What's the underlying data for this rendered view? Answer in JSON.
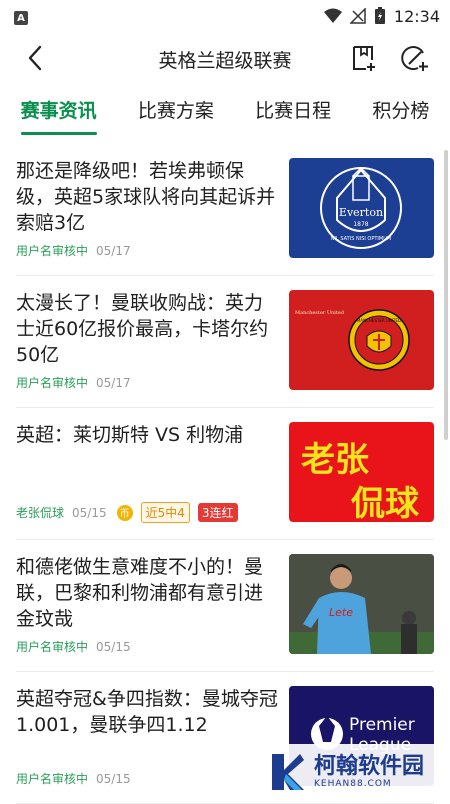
{
  "status_bar": {
    "time": "12:34",
    "left_badge": "A"
  },
  "header": {
    "title": "英格兰超级联赛"
  },
  "tabs": [
    {
      "label": "赛事资讯",
      "active": true
    },
    {
      "label": "比赛方案",
      "active": false
    },
    {
      "label": "比赛日程",
      "active": false
    },
    {
      "label": "积分榜",
      "active": false
    }
  ],
  "articles": [
    {
      "headline": "那还是降级吧！若埃弗顿保级，英超5家球队将向其起诉并索赔3亿",
      "author": "用户名审核中",
      "date": "05/17",
      "thumb": {
        "label": "Everton",
        "year": "1878",
        "motto": "NIL SATIS NISI OPTIMUM",
        "bg": "#1d3f93"
      }
    },
    {
      "headline": "太漫长了！曼联收购战：英力士近60亿报价最高，卡塔尔约50亿",
      "author": "用户名审核中",
      "date": "05/17",
      "thumb": {
        "label": "MANCHESTER UNITED",
        "caption": "Manchester United",
        "bg": "#d11f1f"
      }
    },
    {
      "headline": "英超：莱切斯特 VS 利物浦",
      "author": "老张侃球",
      "date": "05/15",
      "coin": "币",
      "tag1": "近5中4",
      "tag2": "3连红",
      "thumb": {
        "line1": "老张",
        "line2": "侃球",
        "bg": "#e8141a",
        "fg": "#f4e41a"
      }
    },
    {
      "headline": "和德佬做生意难度不小的！曼联，巴黎和利物浦都有意引进金玟哉",
      "author": "用户名审核中",
      "date": "05/15",
      "thumb": {
        "jersey": "Lete",
        "bg": "#3b3b3b"
      }
    },
    {
      "headline": "英超夺冠&争四指数：曼城夺冠1.001，曼联争四1.12",
      "author": "用户名审核中",
      "date": "05/15",
      "thumb": {
        "line1": "Premier",
        "line2": "League",
        "bg": "#1a1466"
      }
    }
  ],
  "watermark": {
    "text": "柯翰软件园",
    "sub": "KEHAN88.COM"
  },
  "colors": {
    "accent": "#0a8f4f",
    "author": "#2aa05a"
  }
}
